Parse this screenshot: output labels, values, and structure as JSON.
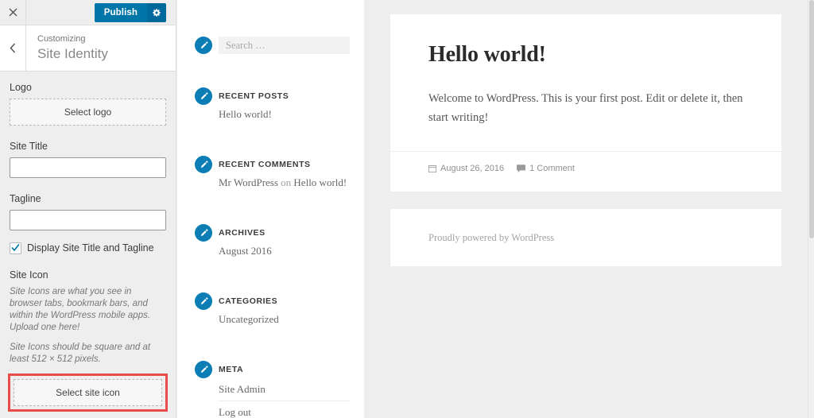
{
  "customizer": {
    "close_icon": "close-icon",
    "publish_label": "Publish",
    "gear_icon": "gear-icon",
    "back_icon": "chevron-left-icon",
    "breadcrumb": "Customizing",
    "panel_title": "Site Identity",
    "logo": {
      "label": "Logo",
      "button_label": "Select logo"
    },
    "site_title": {
      "label": "Site Title",
      "value": "",
      "placeholder": ""
    },
    "tagline": {
      "label": "Tagline",
      "value": "",
      "placeholder": ""
    },
    "display_checkbox": {
      "label": "Display Site Title and Tagline",
      "checked": true
    },
    "site_icon": {
      "label": "Site Icon",
      "description_1": "Site Icons are what you see in browser tabs, bookmark bars, and within the WordPress mobile apps. Upload one here!",
      "description_2": "Site Icons should be square and at least 512 × 512 pixels.",
      "button_label": "Select site icon",
      "highlight_color": "#e94b4b"
    },
    "accent_color": "#0076a8"
  },
  "preview": {
    "widgets": [
      {
        "type": "search",
        "edit_icon": "edit-pencil-icon",
        "placeholder": "Search …"
      },
      {
        "type": "list",
        "edit_icon": "edit-pencil-icon",
        "title": "RECENT POSTS",
        "items": [
          "Hello world!"
        ]
      },
      {
        "type": "comments",
        "edit_icon": "edit-pencil-icon",
        "title": "RECENT COMMENTS",
        "comment_author": "Mr WordPress",
        "comment_on": "on",
        "comment_post": "Hello world!"
      },
      {
        "type": "list",
        "edit_icon": "edit-pencil-icon",
        "title": "ARCHIVES",
        "items": [
          "August 2016"
        ]
      },
      {
        "type": "list",
        "edit_icon": "edit-pencil-icon",
        "title": "CATEGORIES",
        "items": [
          "Uncategorized"
        ]
      },
      {
        "type": "meta",
        "edit_icon": "edit-pencil-icon",
        "title": "META",
        "items": [
          "Site Admin",
          "Log out"
        ]
      }
    ],
    "post": {
      "title": "Hello world!",
      "body": "Welcome to WordPress. This is your first post. Edit or delete it, then start writing!",
      "date_icon": "calendar-icon",
      "date": "August 26, 2016",
      "comment_icon": "comment-bubble-icon",
      "comments": "1 Comment"
    },
    "footer_credit": "Proudly powered by WordPress"
  }
}
